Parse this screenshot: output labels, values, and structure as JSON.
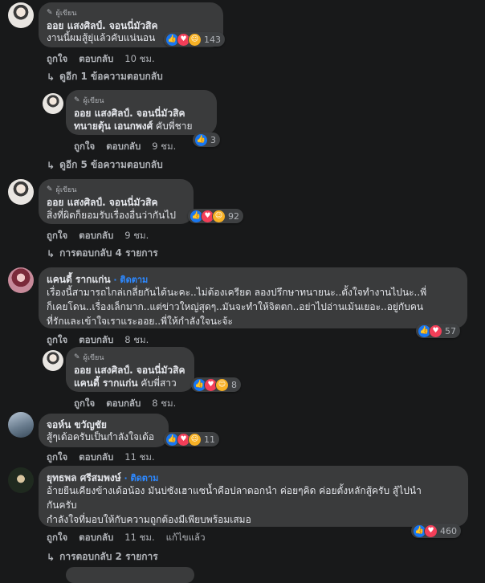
{
  "comments": [
    {
      "author_badge": "ผู้เขียน",
      "author": "ออย แสงศิลป์. จอนนี่มัวสิค",
      "text": "งานนี้ผมสู้ยุ่แล้วคับแน่นอน",
      "reactions": "143",
      "like": "ถูกใจ",
      "reply": "ตอบกลับ",
      "time": "10 ชม.",
      "more_replies": "ดูอีก 1 ข้อความตอบกลับ"
    },
    {
      "author_badge": "ผู้เขียน",
      "author": "ออย แสงศิลป์. จอนนี่มัวสิค",
      "tag": "ทนายตุ้น เอนกพงศ์",
      "text": " คับพี่ชาย",
      "reactions": "3",
      "like": "ถูกใจ",
      "reply": "ตอบกลับ",
      "time": "9 ชม.",
      "more_replies": "ดูอีก 5 ข้อความตอบกลับ"
    },
    {
      "author_badge": "ผู้เขียน",
      "author": "ออย แสงศิลป์. จอนนี่มัวสิค",
      "text": "สิ่งที่ผิดก็ยอมรับเรื่องอื่นว่ากันไป",
      "reactions": "92",
      "like": "ถูกใจ",
      "reply": "ตอบกลับ",
      "time": "9 ชม.",
      "more_replies": "การตอบกลับ 4 รายการ"
    },
    {
      "author": "แคนดี้ รากแก่น",
      "follow": "· ติดตาม",
      "lines": [
        "เรื่องนี้สามารถไกล่เกลี่ยกันได้นะคะ..ไม่ต้องเครียด ลองปรึกษาทนายนะ..ตั้งใจทำงานไปนะ..พี่",
        "ก็เคยโดน..เรื่องเล็กมาก..แต่ข่าวใหญ่สุดๆ..มันจะทำให้จิตตก..อย่าไปอ่านเม้นเยอะ..อยู่กับคน",
        "ที่รักและเข้าใจเราแระออย..พี่ให้กำลังใจนะจ้ะ"
      ],
      "reactions": "57",
      "like": "ถูกใจ",
      "reply": "ตอบกลับ",
      "time": "8 ชม."
    },
    {
      "author_badge": "ผู้เขียน",
      "author": "ออย แสงศิลป์. จอนนี่มัวสิค",
      "tag": "แคนดี้ รากแก่น",
      "text": " คับพี่สาว",
      "reactions": "8",
      "like": "ถูกใจ",
      "reply": "ตอบกลับ",
      "time": "8 ชม."
    },
    {
      "author": "จอห์น ขวัญชัย",
      "text": "สู้ๆเด้อครับเป็นกำลังใจเด้อ",
      "reactions": "11",
      "like": "ถูกใจ",
      "reply": "ตอบกลับ",
      "time": "11 ชม."
    },
    {
      "author": "ยุทธพล ศรีสมพงษ์",
      "follow": "· ติดตาม",
      "lines": [
        "อ้ายยืนเคียงข้างเด้อน้อง มันบ่ซังเฮาแซน้ำคือปลาดอกนำ ค่อยๆคิด ค่อยตั้งหลักสู้ครับ สู้ไปนำ",
        "กันครับ",
        "กำลังใจที่มอบให้กับความถูกต้องมีเพียบพร้อมเสมอ"
      ],
      "reactions": "460",
      "like": "ถูกใจ",
      "reply": "ตอบกลับ",
      "time": "11 ชม.",
      "edited": "แก้ไขแล้ว",
      "more_replies": "การตอบกลับ 2 รายการ"
    }
  ]
}
